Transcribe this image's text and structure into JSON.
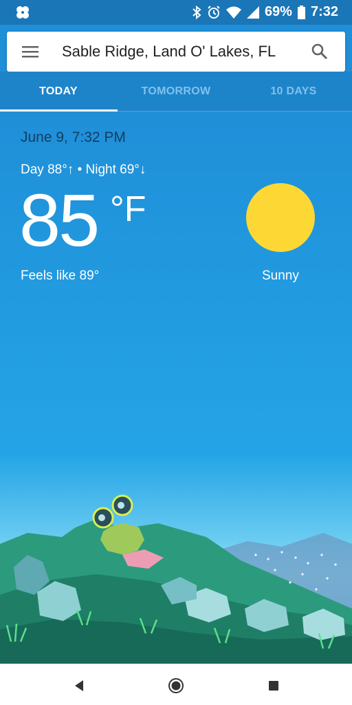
{
  "status_bar": {
    "battery_percent": "69%",
    "time": "7:32",
    "icons": [
      "pinwheel-icon",
      "bluetooth-icon",
      "alarm-icon",
      "wifi-icon",
      "signal-icon",
      "battery-icon"
    ]
  },
  "search": {
    "location": "Sable Ridge, Land O' Lakes, FL"
  },
  "tabs": [
    {
      "label": "TODAY",
      "active": true
    },
    {
      "label": "TOMORROW",
      "active": false
    },
    {
      "label": "10 DAYS",
      "active": false
    }
  ],
  "weather": {
    "date_time": "June 9, 7:32 PM",
    "day_night": "Day 88°↑ • Night 69°↓",
    "temperature": "85",
    "unit": "°F",
    "feels_like": "Feels like 89°",
    "condition": "Sunny"
  },
  "colors": {
    "status_bar": "#1a76b6",
    "tab_bar": "#1e84c9",
    "sky": "#24a4e6",
    "sun": "#fdd835"
  },
  "nav": {
    "icons": [
      "back-icon",
      "home-icon",
      "recents-icon"
    ]
  }
}
